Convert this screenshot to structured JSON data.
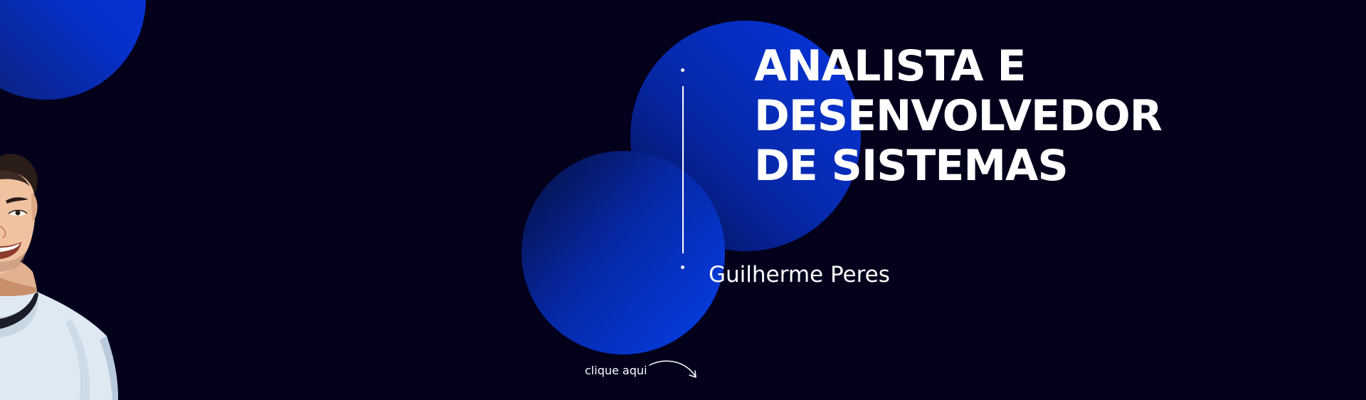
{
  "hero": {
    "title_lines": [
      "ANALISTA E",
      "DESENVOLVEDOR",
      "DE SISTEMAS"
    ],
    "name": "Guilherme Peres",
    "cta_label": "clique aqui",
    "cta_icon": "curved-arrow-icon",
    "avatar_icon": "avatar-illustration"
  },
  "colors": {
    "background": "#04001c",
    "accent": "#0538e0",
    "text": "#ffffff"
  }
}
